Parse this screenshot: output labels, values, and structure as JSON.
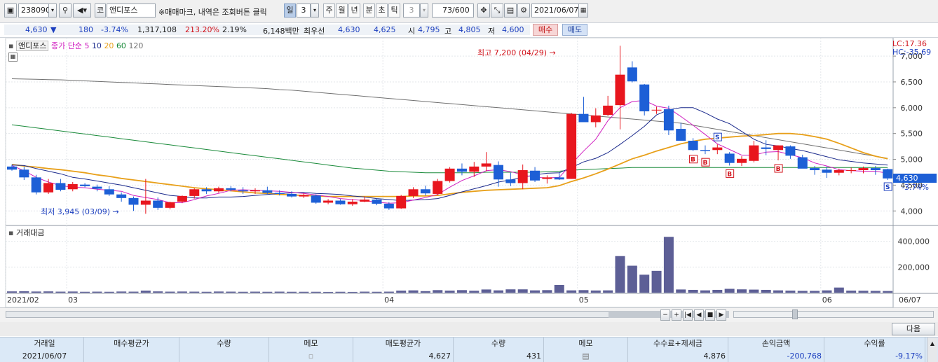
{
  "toolbar": {
    "code": "238090",
    "market": "코",
    "stock_name": "앤디포스",
    "notice": "※매매마크, 내역은 조회버튼 클릭",
    "period_day": "일",
    "period_num": "3",
    "period_week": "주",
    "period_month": "월",
    "period_year": "년",
    "period_min": "분",
    "period_sec": "초",
    "period_tick": "틱",
    "tick_num": "3",
    "count": "73",
    "count_total": "/600",
    "date": "2021/06/07"
  },
  "quote": {
    "price": "4,630",
    "arrow": "▼",
    "change": "180",
    "change_pct": "-3.74%",
    "volume": "1,317,108",
    "volume_ratio": "213.20%",
    "turnover": "2.19%",
    "amount": "6,148백만",
    "best_ask_label": "최우선",
    "best_ask": "4,630",
    "best_bid": "4,625",
    "open_label": "시",
    "open": "4,795",
    "high_label": "고",
    "high": "4,805",
    "low_label": "저",
    "low": "4,600",
    "buy_label": "매수",
    "sell_label": "매도"
  },
  "legend": {
    "name": "앤디포스",
    "ma_label": "종가 단순",
    "ma5": "5",
    "ma10": "10",
    "ma20": "20",
    "ma60": "60",
    "ma120": "120"
  },
  "colors": {
    "up": "#e8161e",
    "down": "#1d5fd6",
    "ma5": "#d020c0",
    "ma10": "#1b2a8c",
    "ma20": "#e8a01a",
    "ma60": "#1a8a3a",
    "ma120": "#707070",
    "volume": "#5d5f96"
  },
  "chart_data": {
    "type": "candlestick",
    "ylim": [
      3800,
      7300
    ],
    "y_ticks": [
      "7,000",
      "6,500",
      "6,000",
      "5,500",
      "5,000",
      "4,500",
      "4,000"
    ],
    "y_tick_values": [
      7000,
      6500,
      6000,
      5500,
      5000,
      4500,
      4000
    ],
    "lc_label": "LC:17.36",
    "hc_label": "HC:-35.69",
    "last_price_label": "4,630",
    "last_pct_label": "-3.74%",
    "high_annotation": "최고 7,200 (04/29) →",
    "low_annotation": "최저 3,945 (03/09) →",
    "candles": [
      [
        4860,
        4900,
        4780,
        4800
      ],
      [
        4800,
        4860,
        4600,
        4650
      ],
      [
        4650,
        4700,
        4320,
        4360
      ],
      [
        4360,
        4620,
        4330,
        4540
      ],
      [
        4540,
        4620,
        4380,
        4410
      ],
      [
        4420,
        4560,
        4380,
        4520
      ],
      [
        4510,
        4540,
        4460,
        4480
      ],
      [
        4470,
        4510,
        4380,
        4430
      ],
      [
        4420,
        4480,
        4290,
        4320
      ],
      [
        4320,
        4360,
        4180,
        4250
      ],
      [
        4250,
        4280,
        4000,
        4120
      ],
      [
        4120,
        4620,
        3945,
        4200
      ],
      [
        4200,
        4260,
        4020,
        4060
      ],
      [
        4060,
        4180,
        4030,
        4170
      ],
      [
        4180,
        4300,
        4150,
        4290
      ],
      [
        4290,
        4440,
        4240,
        4420
      ],
      [
        4420,
        4460,
        4330,
        4380
      ],
      [
        4380,
        4470,
        4350,
        4440
      ],
      [
        4440,
        4480,
        4380,
        4410
      ],
      [
        4400,
        4460,
        4330,
        4380
      ],
      [
        4380,
        4440,
        4330,
        4400
      ],
      [
        4400,
        4470,
        4330,
        4350
      ],
      [
        4350,
        4400,
        4300,
        4330
      ],
      [
        4330,
        4380,
        4260,
        4280
      ],
      [
        4280,
        4340,
        4250,
        4310
      ],
      [
        4300,
        4320,
        4140,
        4160
      ],
      [
        4160,
        4230,
        4130,
        4200
      ],
      [
        4200,
        4230,
        4120,
        4130
      ],
      [
        4130,
        4230,
        4100,
        4180
      ],
      [
        4180,
        4280,
        4170,
        4220
      ],
      [
        4220,
        4240,
        4110,
        4140
      ],
      [
        4140,
        4170,
        4020,
        4050
      ],
      [
        4050,
        4310,
        4040,
        4290
      ],
      [
        4290,
        4460,
        4250,
        4420
      ],
      [
        4420,
        4490,
        4300,
        4340
      ],
      [
        4330,
        4620,
        4310,
        4580
      ],
      [
        4580,
        4850,
        4550,
        4820
      ],
      [
        4820,
        4920,
        4690,
        4760
      ],
      [
        4760,
        4950,
        4660,
        4860
      ],
      [
        4860,
        5140,
        4770,
        4920
      ],
      [
        4890,
        4960,
        4470,
        4610
      ],
      [
        4610,
        4740,
        4480,
        4540
      ],
      [
        4540,
        4900,
        4420,
        4790
      ],
      [
        4780,
        4850,
        4560,
        4590
      ],
      [
        4620,
        4690,
        4530,
        4650
      ],
      [
        4650,
        4740,
        4600,
        4610
      ],
      [
        4620,
        5900,
        4620,
        5880
      ],
      [
        5880,
        6210,
        5760,
        5720
      ],
      [
        5720,
        5990,
        5620,
        5850
      ],
      [
        5860,
        6230,
        5840,
        6040
      ],
      [
        6050,
        7200,
        5580,
        6640
      ],
      [
        6780,
        6900,
        6490,
        6510
      ],
      [
        6450,
        6460,
        5850,
        5930
      ],
      [
        5950,
        6020,
        5880,
        5960
      ],
      [
        5970,
        6040,
        5470,
        5560
      ],
      [
        5590,
        5710,
        5440,
        5360
      ],
      [
        5360,
        5410,
        5160,
        5180
      ],
      [
        5180,
        5270,
        5100,
        5160
      ],
      [
        5180,
        5290,
        5100,
        5230
      ],
      [
        5110,
        5140,
        4880,
        4930
      ],
      [
        4930,
        5060,
        4870,
        5010
      ],
      [
        4970,
        5360,
        4940,
        5270
      ],
      [
        5230,
        5370,
        5080,
        5200
      ],
      [
        5180,
        5270,
        4980,
        5270
      ],
      [
        5250,
        5270,
        5010,
        5070
      ],
      [
        5040,
        5090,
        4830,
        4820
      ],
      [
        4830,
        4870,
        4700,
        4790
      ],
      [
        4800,
        4860,
        4640,
        4740
      ],
      [
        4740,
        4820,
        4690,
        4790
      ],
      [
        4780,
        4840,
        4730,
        4790
      ],
      [
        4790,
        4860,
        4730,
        4830
      ],
      [
        4830,
        4870,
        4700,
        4790
      ],
      [
        4810,
        4820,
        4600,
        4630
      ]
    ],
    "ma5": [
      4880,
      4780,
      4650,
      4560,
      4490,
      4460,
      4450,
      4420,
      4400,
      4380,
      4300,
      4260,
      4220,
      4160,
      4160,
      4220,
      4290,
      4340,
      4400,
      4410,
      4400,
      4390,
      4380,
      4360,
      4340,
      4310,
      4280,
      4240,
      4220,
      4200,
      4170,
      4150,
      4160,
      4210,
      4260,
      4320,
      4460,
      4590,
      4680,
      4780,
      4800,
      4760,
      4700,
      4650,
      4640,
      4650,
      4910,
      5160,
      5390,
      5750,
      6000,
      6120,
      6140,
      6030,
      5990,
      5830,
      5660,
      5480,
      5300,
      5190,
      5080,
      5080,
      5140,
      5150,
      5090,
      5030,
      4930,
      4870,
      4800,
      4780,
      4770,
      4770,
      4730
    ],
    "ma10": [
      4890,
      4880,
      4820,
      4770,
      4720,
      4650,
      4620,
      4580,
      4540,
      4500,
      4450,
      4400,
      4350,
      4300,
      4280,
      4250,
      4250,
      4270,
      4270,
      4280,
      4300,
      4320,
      4340,
      4350,
      4360,
      4340,
      4330,
      4320,
      4290,
      4270,
      4240,
      4220,
      4200,
      4210,
      4220,
      4240,
      4300,
      4370,
      4430,
      4490,
      4560,
      4600,
      4650,
      4700,
      4730,
      4740,
      4840,
      4950,
      5020,
      5130,
      5290,
      5460,
      5640,
      5860,
      5960,
      6000,
      6000,
      5900,
      5780,
      5690,
      5540,
      5390,
      5290,
      5260,
      5210,
      5170,
      5110,
      5050,
      4990,
      4960,
      4930,
      4910,
      4890
    ],
    "ma20": [
      4900,
      4870,
      4850,
      4820,
      4800,
      4770,
      4740,
      4700,
      4670,
      4630,
      4600,
      4570,
      4540,
      4510,
      4480,
      4450,
      4430,
      4410,
      4390,
      4370,
      4350,
      4340,
      4320,
      4310,
      4300,
      4290,
      4280,
      4280,
      4280,
      4280,
      4280,
      4280,
      4280,
      4290,
      4290,
      4300,
      4330,
      4360,
      4380,
      4400,
      4410,
      4420,
      4430,
      4440,
      4450,
      4490,
      4570,
      4640,
      4720,
      4810,
      4910,
      5010,
      5080,
      5160,
      5230,
      5300,
      5350,
      5390,
      5410,
      5430,
      5450,
      5460,
      5480,
      5500,
      5500,
      5480,
      5440,
      5390,
      5310,
      5220,
      5130,
      5060,
      5010
    ],
    "ma60": [
      5670,
      5640,
      5610,
      5580,
      5550,
      5520,
      5490,
      5460,
      5430,
      5400,
      5370,
      5340,
      5310,
      5280,
      5250,
      5220,
      5190,
      5160,
      5130,
      5100,
      5070,
      5040,
      5010,
      4980,
      4950,
      4920,
      4890,
      4860,
      4830,
      4810,
      4790,
      4770,
      4760,
      4750,
      4740,
      4740,
      4740,
      4740,
      4740,
      4750,
      4750,
      4750,
      4750,
      4750,
      4760,
      4770,
      4790,
      4800,
      4810,
      4820,
      4830,
      4840,
      4840,
      4840,
      4840,
      4840,
      4840,
      4840,
      4840,
      4840,
      4840,
      4840,
      4840,
      4840,
      4840,
      4840,
      4840,
      4840,
      4840,
      4840,
      4840,
      4840,
      4840
    ],
    "ma120": [
      6560,
      6555,
      6550,
      6545,
      6540,
      6530,
      6520,
      6510,
      6500,
      6490,
      6480,
      6470,
      6460,
      6450,
      6440,
      6430,
      6420,
      6410,
      6400,
      6390,
      6380,
      6370,
      6350,
      6340,
      6320,
      6300,
      6280,
      6260,
      6240,
      6220,
      6200,
      6180,
      6160,
      6140,
      6120,
      6100,
      6080,
      6060,
      6040,
      6020,
      6000,
      5980,
      5960,
      5940,
      5920,
      5900,
      5880,
      5860,
      5840,
      5820,
      5800,
      5780,
      5760,
      5740,
      5720,
      5700,
      5660,
      5620,
      5580,
      5540,
      5500,
      5460,
      5420,
      5380,
      5340,
      5300,
      5260,
      5220,
      5180,
      5140,
      5100,
      5060,
      5020
    ],
    "buy_marks_index": [
      56,
      57,
      59,
      63
    ],
    "sell_marks_index": [
      58,
      72
    ],
    "volume_label": "거래대금",
    "volume_ticks": [
      "400,000",
      "200,000"
    ],
    "volume_tick_values": [
      400000,
      200000
    ],
    "volume_ylim": [
      0,
      480000
    ],
    "volume": [
      10000,
      11000,
      9000,
      10000,
      8000,
      9000,
      7000,
      8000,
      7000,
      9000,
      8000,
      16000,
      10000,
      8000,
      9000,
      8000,
      7000,
      9000,
      8000,
      7000,
      8000,
      7000,
      8000,
      7000,
      7000,
      7000,
      6000,
      7000,
      6000,
      8000,
      7000,
      8000,
      16000,
      18000,
      12000,
      20000,
      16000,
      20000,
      15000,
      25000,
      18000,
      26000,
      26000,
      18000,
      20000,
      60000,
      18000,
      20000,
      17000,
      18000,
      285000,
      210000,
      140000,
      170000,
      435000,
      25000,
      22000,
      18000,
      22000,
      30000,
      26000,
      24000,
      22000,
      18000,
      16000,
      14000,
      14000,
      18000,
      40000,
      16000,
      15000,
      14000,
      13000,
      12000,
      12000,
      13000,
      12000,
      11000,
      11000
    ],
    "x_labels": [
      "2021/02",
      "03",
      "04",
      "05",
      "06",
      "06/07"
    ]
  },
  "navbar": {
    "btn_zoom_out": "−",
    "btn_zoom_in": "+",
    "btn_first": "|◀",
    "btn_prev": "◀",
    "btn_stop": "■",
    "btn_next": "▶",
    "btn_last": "▶|"
  },
  "next_button": "다음",
  "table": {
    "headers": [
      "거래일",
      "매수평균가",
      "수량",
      "메모",
      "매도평균가",
      "수량",
      "메모",
      "수수료+제세금",
      "손익금액",
      "수익률"
    ],
    "row": [
      "2021/06/07",
      "",
      "",
      "",
      "4,627",
      "431",
      "",
      "4,876",
      "-200,768",
      "-9.17%"
    ]
  }
}
